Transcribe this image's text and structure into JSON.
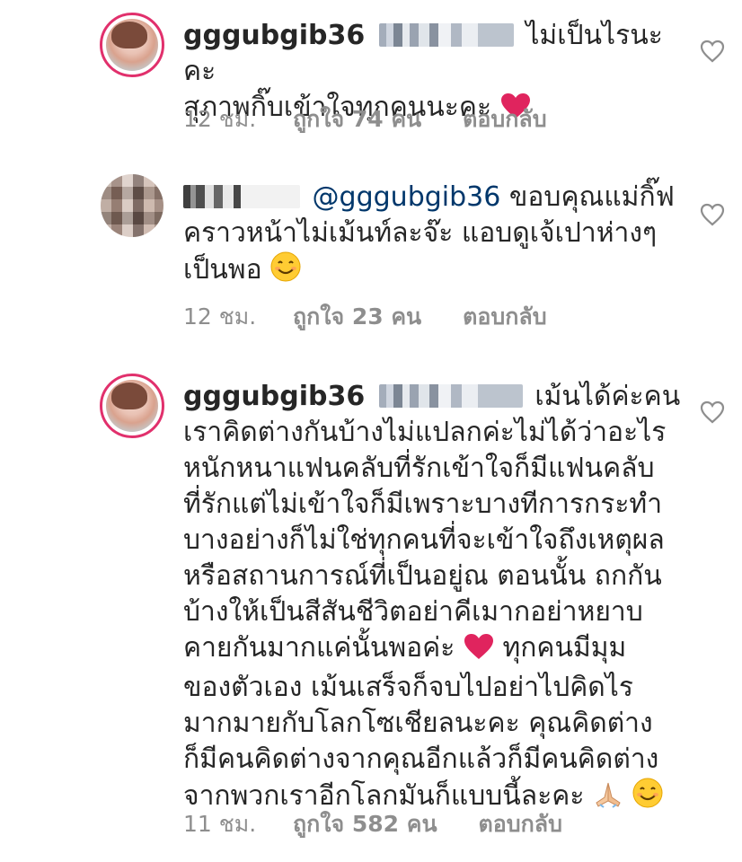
{
  "comments": [
    {
      "username": "gggubgib36",
      "lines": [
        "ไม่เป็นไรนะคะ",
        "สุภาพกิ๊บเข้าใจทุกคนนะคะ"
      ],
      "time": "12 ชม.",
      "likes": "ถูกใจ 74 คน",
      "reply": "ตอบกลับ"
    },
    {
      "mention": "@gggubgib36",
      "lines": [
        "ขอบคุณแม่กิ๊ฟ",
        "คราวหน้าไม่เม้นท์ละจ๊ะ แอบดูเจ้เปาห่างๆ",
        "เป็นพอ"
      ],
      "time": "12 ชม.",
      "likes": "ถูกใจ 23 คน",
      "reply": "ตอบกลับ"
    },
    {
      "username": "gggubgib36",
      "lines": [
        "เม้นได้ค่ะคน",
        "เราคิดต่างกันบ้างไม่แปลกค่ะไม่ได้ว่าอะไร",
        "หนักหนาแฟนคลับที่รักเข้าใจก็มีแฟนคลับ",
        "ที่รักแต่ไม่เข้าใจก็มีเพราะบางทีการกระทำ",
        "บางอย่างก็ไม่ใช่ทุกคนที่จะเข้าใจถึงเหตุผล",
        "หรือสถานการณ์ที่เป็นอยู่ณ ตอนนั้น ถกกัน",
        "บ้างให้เป็นสีสันชีวิตอย่าคีเมากอย่าหยาบ",
        "คายกันมากแค่นั้นพอค่ะ",
        "ทุกคนมีมุม",
        "ของตัวเอง เม้นเสร็จก็จบไปอย่าไปคิดไร",
        "มากมายกับโลกโซเชียลนะคะ คุณคิดต่าง",
        "ก็มีคนคิดต่างจากคุณอีกแล้วก็มีคนคิดต่าง",
        "จากพวกเราอีกโลกมันก็แบบนี้ละคะ"
      ],
      "time": "11 ชม.",
      "likes": "ถูกใจ 582 คน",
      "reply": "ตอบกลับ"
    }
  ],
  "icons": {
    "like": "heart-outline-icon",
    "red_heart": "red-heart-emoji",
    "smile": "smiling-face-emoji",
    "pray": "folded-hands-emoji"
  },
  "colors": {
    "text": "#262626",
    "meta": "#8e8e8e",
    "mention": "#00376b",
    "story_ring": "#e1306c",
    "heart_emoji": "#e0245e"
  }
}
